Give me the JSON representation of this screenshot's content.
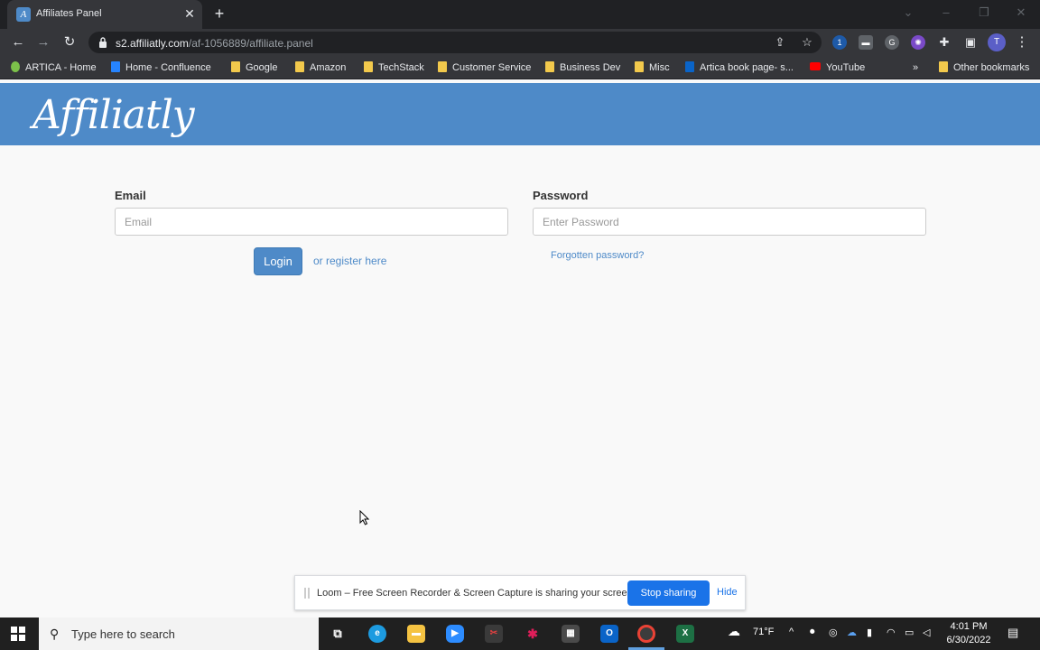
{
  "browser": {
    "tab_title": "Affiliates Panel",
    "tab_favicon_letter": "A",
    "url_host": "s2.affiliatly.com",
    "url_path": "/af-1056889/affiliate.panel",
    "profile_initial": "T",
    "bookmarks": [
      {
        "label": "ARTICA - Home",
        "icon": "artica-favicon",
        "color": "#7cc14a"
      },
      {
        "label": "Home - Confluence",
        "icon": "confluence-favicon",
        "color": "#2684ff"
      },
      {
        "label": "Google",
        "icon": "folder-icon",
        "color": "#f2c94c"
      },
      {
        "label": "Amazon",
        "icon": "folder-icon",
        "color": "#f2c94c"
      },
      {
        "label": "TechStack",
        "icon": "folder-icon",
        "color": "#f2c94c"
      },
      {
        "label": "Customer Service",
        "icon": "folder-icon",
        "color": "#f2c94c"
      },
      {
        "label": "Business Dev",
        "icon": "folder-icon",
        "color": "#f2c94c"
      },
      {
        "label": "Misc",
        "icon": "folder-icon",
        "color": "#f2c94c"
      },
      {
        "label": "Artica book page- s...",
        "icon": "outlook-favicon",
        "color": "#0a64c8"
      },
      {
        "label": "YouTube",
        "icon": "youtube-favicon",
        "color": "#ff0000"
      }
    ],
    "more_bookmarks": "»",
    "other_bookmarks": "Other bookmarks"
  },
  "page": {
    "logo_text": "Affiliatly",
    "email_label": "Email",
    "email_placeholder": "Email",
    "password_label": "Password",
    "password_placeholder": "Enter Password",
    "login_button": "Login",
    "register_link": "or register here",
    "forgot_link": "Forgotten password?",
    "brand_color": "#4e8ac8"
  },
  "loom_bar": {
    "text": "Loom – Free Screen Recorder & Screen Capture is sharing your screen.",
    "stop_button": "Stop sharing",
    "hide_link": "Hide"
  },
  "taskbar": {
    "search_placeholder": "Type here to search",
    "weather": "71°F",
    "time": "4:01 PM",
    "date": "6/30/2022"
  }
}
